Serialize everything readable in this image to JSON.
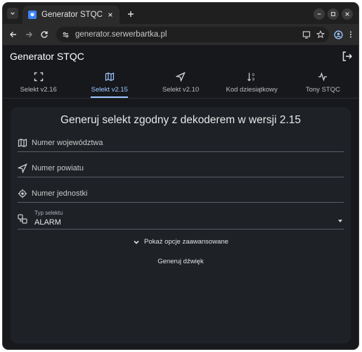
{
  "browser": {
    "tab_title": "Generator STQC",
    "url": "generator.serwerbartka.pl"
  },
  "app": {
    "title": "Generator STQC",
    "tabs": [
      {
        "label": "Selekt v2.16",
        "icon": "fullscreen-icon"
      },
      {
        "label": "Selekt v2.15",
        "icon": "map-icon"
      },
      {
        "label": "Selekt v2.10",
        "icon": "navigation-icon"
      },
      {
        "label": "Kod dziesiątkowy",
        "icon": "sort-numeric-icon"
      },
      {
        "label": "Tony STQC",
        "icon": "pulse-icon"
      }
    ],
    "active_tab": "Selekt v2.15"
  },
  "form": {
    "heading": "Generuj selekt zgodny z dekoderem w wersji 2.15",
    "fields": {
      "wojewodztwo": "Numer województwa",
      "powiat": "Numer powiatu",
      "jednostka": "Numer jednostki"
    },
    "select": {
      "label": "Typ selektu",
      "value": "ALARM"
    },
    "advanced_label": "Pokaż opcje zaawansowane",
    "generate_label": "Generuj dźwięk"
  },
  "colors": {
    "accent": "#9ec7ff",
    "card": "#1e2126",
    "background": "#16181c"
  }
}
